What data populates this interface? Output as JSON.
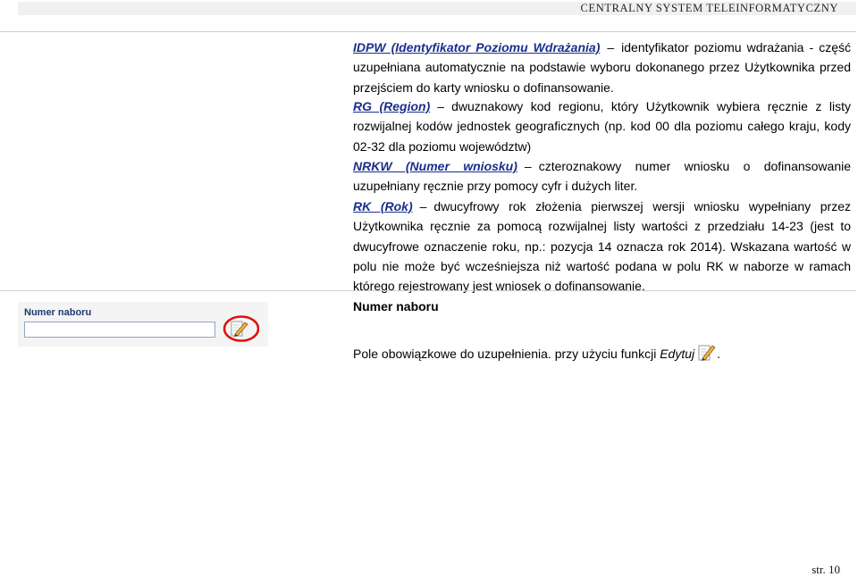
{
  "header": {
    "title": "CENTRALNY SYSTEM TELEINFORMATYCZNY"
  },
  "definitions": [
    {
      "term": "IDPW (Identyfikator Poziomu Wdrażania)",
      "text": "identyfikator poziomu wdrażania - część uzupełniana automatycznie na podstawie wyboru dokonanego przez Użytkownika przed przejściem do karty wniosku o dofinansowanie."
    },
    {
      "term": "RG (Region)",
      "text": "dwuznakowy kod regionu, który Użytkownik wybiera ręcznie z listy rozwijalnej kodów jednostek geograficznych (np. kod 00 dla poziomu całego kraju, kody 02-32 dla poziomu województw)"
    },
    {
      "term": "NRKW (Numer wniosku)",
      "text": "czteroznakowy numer wniosku o dofinansowanie uzupełniany ręcznie przy pomocy cyfr i dużych liter."
    },
    {
      "term": "RK (Rok)",
      "text": "dwucyfrowy rok złożenia pierwszej wersji wniosku wypełniany przez Użytkownika ręcznie za pomocą rozwijalnej listy wartości z przedziału 14-23 (jest to dwucyfrowe oznaczenie roku, np.: pozycja 14 oznacza rok 2014). Wskazana wartość w polu nie może być wcześniejsza niż wartość podana w polu RK w naborze w ramach którego rejestrowany jest wniosek o dofinansowanie."
    }
  ],
  "widget": {
    "label": "Numer naboru",
    "value": ""
  },
  "section": {
    "heading": "Numer naboru",
    "text_before": "Pole obowiązkowe do uzupełnienia. przy użyciu funkcji ",
    "function_name": "Edytuj",
    "text_after": "."
  },
  "footer": {
    "page": "str. 10"
  },
  "colors": {
    "term": "#1a2f8c",
    "highlight_circle": "#e01010",
    "label": "#1f3a6e"
  },
  "icons": [
    "edit-pencil-icon"
  ]
}
